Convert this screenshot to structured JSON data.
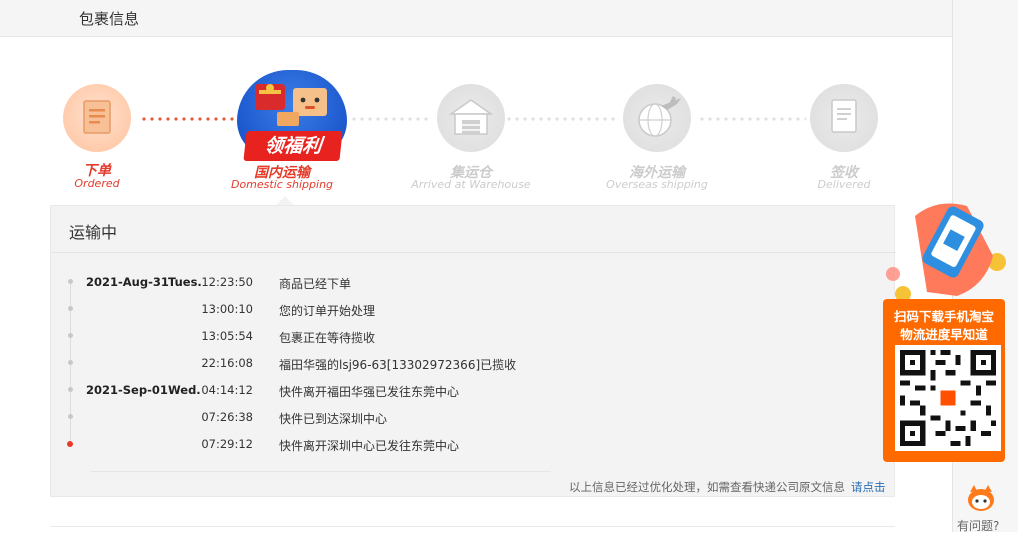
{
  "header": {
    "title": "包裹信息"
  },
  "steps": [
    {
      "cn": "下单",
      "en": "Ordered",
      "state": "done",
      "icon": "receipt-icon"
    },
    {
      "cn": "国内运输",
      "en": "Domestic shipping",
      "state": "current",
      "icon": "gift-box-icon",
      "badge": "领福利"
    },
    {
      "cn": "集运仓",
      "en": "Arrived at Warehouse",
      "state": "pending",
      "icon": "warehouse-icon"
    },
    {
      "cn": "海外运输",
      "en": "Overseas shipping",
      "state": "pending",
      "icon": "airplane-globe-icon"
    },
    {
      "cn": "签收",
      "en": "Delivered",
      "state": "pending",
      "icon": "document-icon"
    }
  ],
  "tracking": {
    "title": "运输中",
    "events": [
      {
        "date": "2021-Aug-31",
        "weekday": "Tues.",
        "time": "12:23:50",
        "desc": "商品已经下单"
      },
      {
        "date": "",
        "weekday": "",
        "time": "13:00:10",
        "desc": "您的订单开始处理"
      },
      {
        "date": "",
        "weekday": "",
        "time": "13:05:54",
        "desc": "包裹正在等待揽收"
      },
      {
        "date": "",
        "weekday": "",
        "time": "22:16:08",
        "desc": "福田华强的lsj96-63[13302972366]已揽收"
      },
      {
        "date": "2021-Sep-01",
        "weekday": "Wed.",
        "time": "04:14:12",
        "desc": "快件离开福田华强已发往东莞中心"
      },
      {
        "date": "",
        "weekday": "",
        "time": "07:26:38",
        "desc": "快件已到达深圳中心"
      },
      {
        "date": "",
        "weekday": "",
        "time": "07:29:12",
        "desc": "快件离开深圳中心已发往东莞中心"
      }
    ],
    "footnote": "以上信息已经过优化处理，如需查看快递公司原文信息",
    "footnote_link": "请点击"
  },
  "promo": {
    "line1": "扫码下载手机淘宝",
    "line2": "物流进度早知道",
    "qr_icon": "qr-code-icon"
  },
  "help": {
    "label": "有问题?"
  },
  "colors": {
    "accent": "#ff6a00",
    "done_red": "#e43b2b",
    "pending_gray": "#cccccc",
    "link": "#2a6db5"
  }
}
